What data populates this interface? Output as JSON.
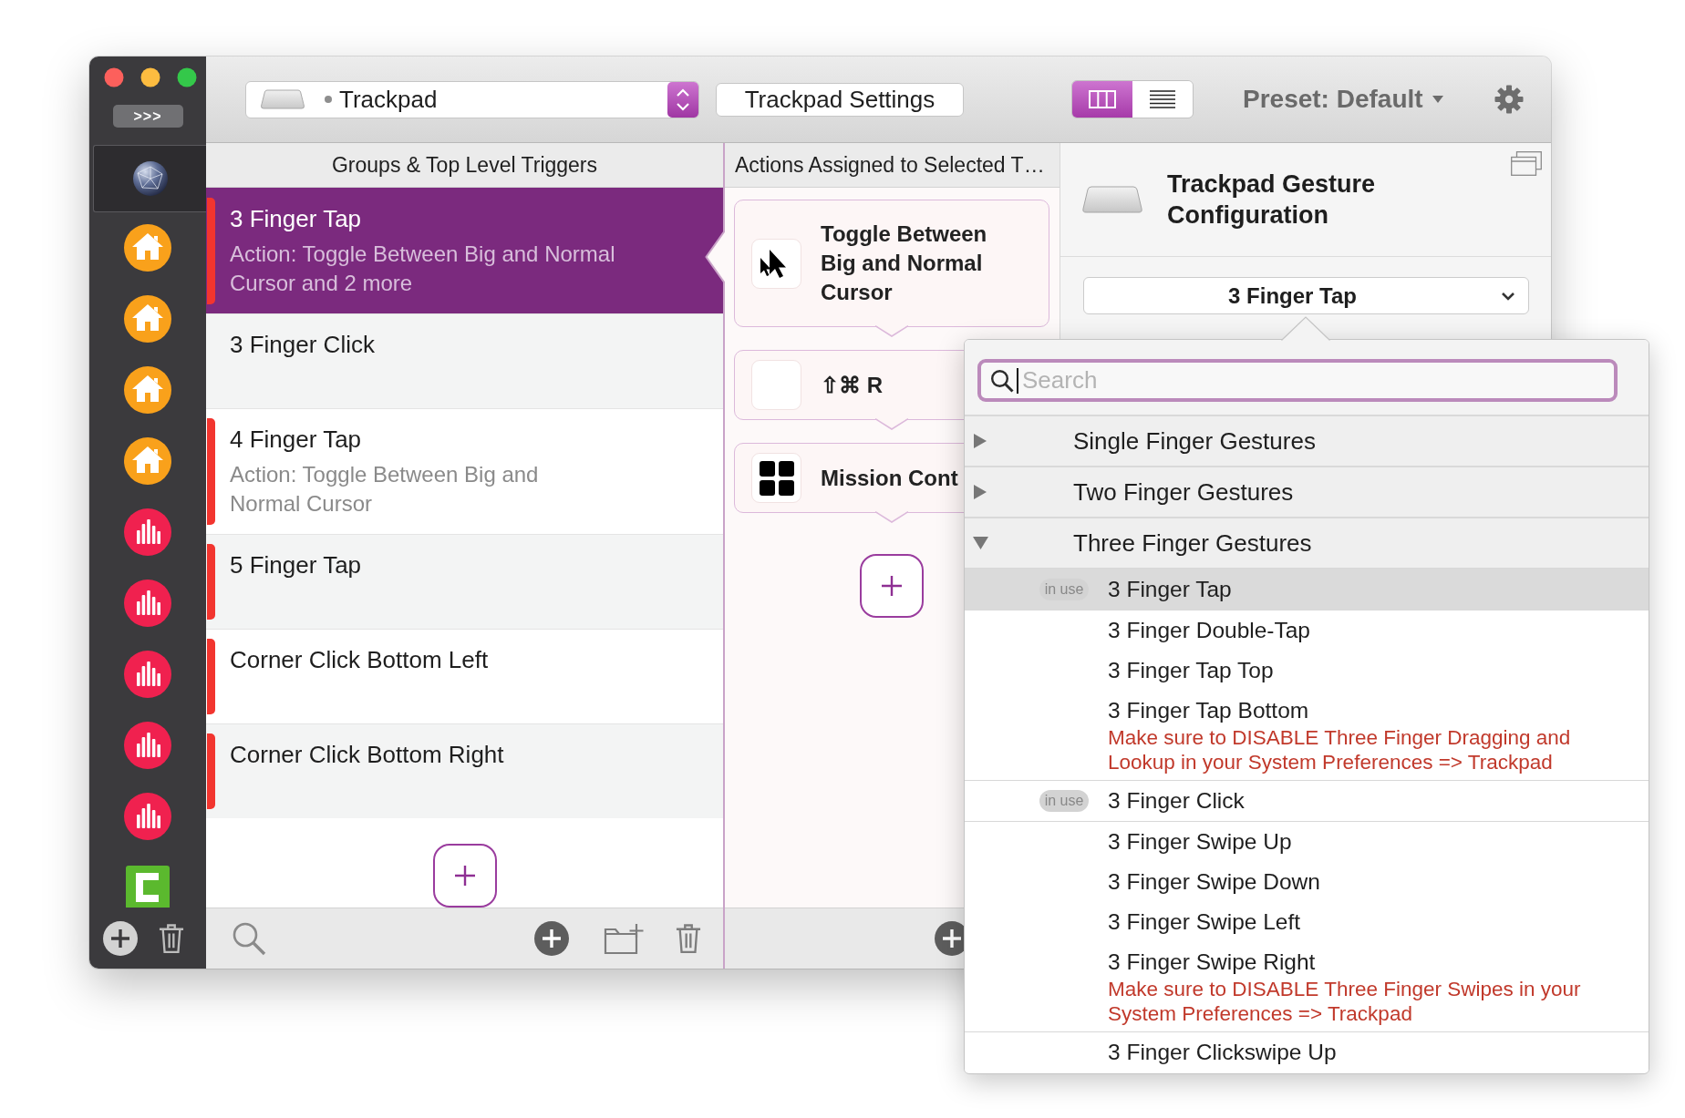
{
  "sidebar": {
    "toggle_label": ">>>",
    "items": [
      {
        "kind": "globe",
        "selected": true
      },
      {
        "kind": "house",
        "selected": false
      },
      {
        "kind": "house",
        "selected": false
      },
      {
        "kind": "house",
        "selected": false
      },
      {
        "kind": "house",
        "selected": false
      },
      {
        "kind": "equalizer",
        "selected": false
      },
      {
        "kind": "equalizer",
        "selected": false
      },
      {
        "kind": "equalizer",
        "selected": false
      },
      {
        "kind": "equalizer",
        "selected": false
      },
      {
        "kind": "equalizer",
        "selected": false
      },
      {
        "kind": "bracket",
        "selected": false
      }
    ]
  },
  "toolbar": {
    "device_selector": {
      "label": "Trackpad"
    },
    "settings_button": "Trackpad Settings",
    "view_modes": [
      {
        "kind": "columns",
        "selected": true
      },
      {
        "kind": "list",
        "selected": false
      }
    ],
    "preset": "Preset: Default"
  },
  "triggers": {
    "header": "Groups & Top Level Triggers",
    "rows": [
      {
        "title": "3 Finger Tap",
        "subtitle": "Action: Toggle Between Big and Normal\nCursor and 2 more",
        "marker": true,
        "selected": true
      },
      {
        "title": "3 Finger Click",
        "marker": false,
        "selected": false
      },
      {
        "title": "4 Finger Tap",
        "subtitle": "Action: Toggle Between Big and\nNormal Cursor",
        "marker": true,
        "selected": false
      },
      {
        "title": "5 Finger Tap",
        "marker": true,
        "selected": false
      },
      {
        "title": "Corner Click Bottom Left",
        "marker": true,
        "selected": false
      },
      {
        "title": "Corner Click Bottom Right",
        "marker": true,
        "selected": false
      }
    ]
  },
  "actions": {
    "header": "Actions Assigned to Selected T…",
    "cards": [
      {
        "kind": "cursor",
        "label": "Toggle Between Big and Normal Cursor"
      },
      {
        "kind": "shortcut",
        "label": "⇧⌘ R"
      },
      {
        "kind": "grid",
        "label": "Mission Cont"
      }
    ]
  },
  "configuration": {
    "title": "Trackpad Gesture Configuration",
    "gesture_selector": {
      "value": "3 Finger Tap"
    }
  },
  "gesture_menu": {
    "search": {
      "placeholder": "Search"
    },
    "groups": [
      {
        "label": "Single Finger Gestures",
        "expanded": false
      },
      {
        "label": "Two Finger Gestures",
        "expanded": false
      },
      {
        "label": "Three Finger Gestures",
        "expanded": true,
        "children": [
          {
            "label": "3 Finger Tap",
            "badge": "in use",
            "selected": true
          },
          {
            "label": "3 Finger Double-Tap",
            "selected": false
          },
          {
            "label": "3 Finger Tap Top",
            "selected": false
          },
          {
            "label": "3 Finger Tap Bottom",
            "warning": "Make sure to DISABLE Three Finger Dragging and Lookup in your System Preferences => Trackpad",
            "selected": false
          },
          {
            "label": "3 Finger Click",
            "badge": "in use",
            "selected": false
          },
          {
            "label": "3 Finger Swipe Up",
            "selected": false
          },
          {
            "label": "3 Finger Swipe Down",
            "selected": false
          },
          {
            "label": "3 Finger Swipe Left",
            "selected": false
          },
          {
            "label": "3 Finger Swipe Right",
            "warning": "Make sure to DISABLE Three Finger Swipes in your System Preferences => Trackpad",
            "selected": false
          },
          {
            "label": "3 Finger Clickswipe Up",
            "selected": false
          }
        ]
      }
    ]
  }
}
